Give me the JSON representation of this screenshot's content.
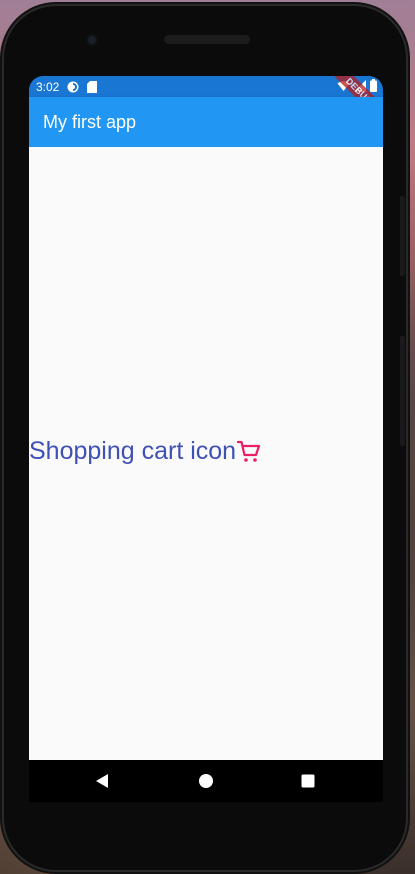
{
  "status_bar": {
    "time": "3:02",
    "color": "#1976d2",
    "icons": [
      "notification-icon",
      "sd-card-icon",
      "wifi-icon",
      "signal-icon",
      "battery-icon"
    ]
  },
  "debug_banner": {
    "label": "DEBUG"
  },
  "app_bar": {
    "title": "My first app",
    "color": "#2196f3"
  },
  "content": {
    "text": "Shopping cart icon",
    "text_color": "#3f51b5",
    "icon": "shopping-cart-icon",
    "icon_color": "#e91e63"
  },
  "nav_bar": {
    "buttons": [
      "back-icon",
      "home-icon",
      "recents-icon"
    ]
  }
}
